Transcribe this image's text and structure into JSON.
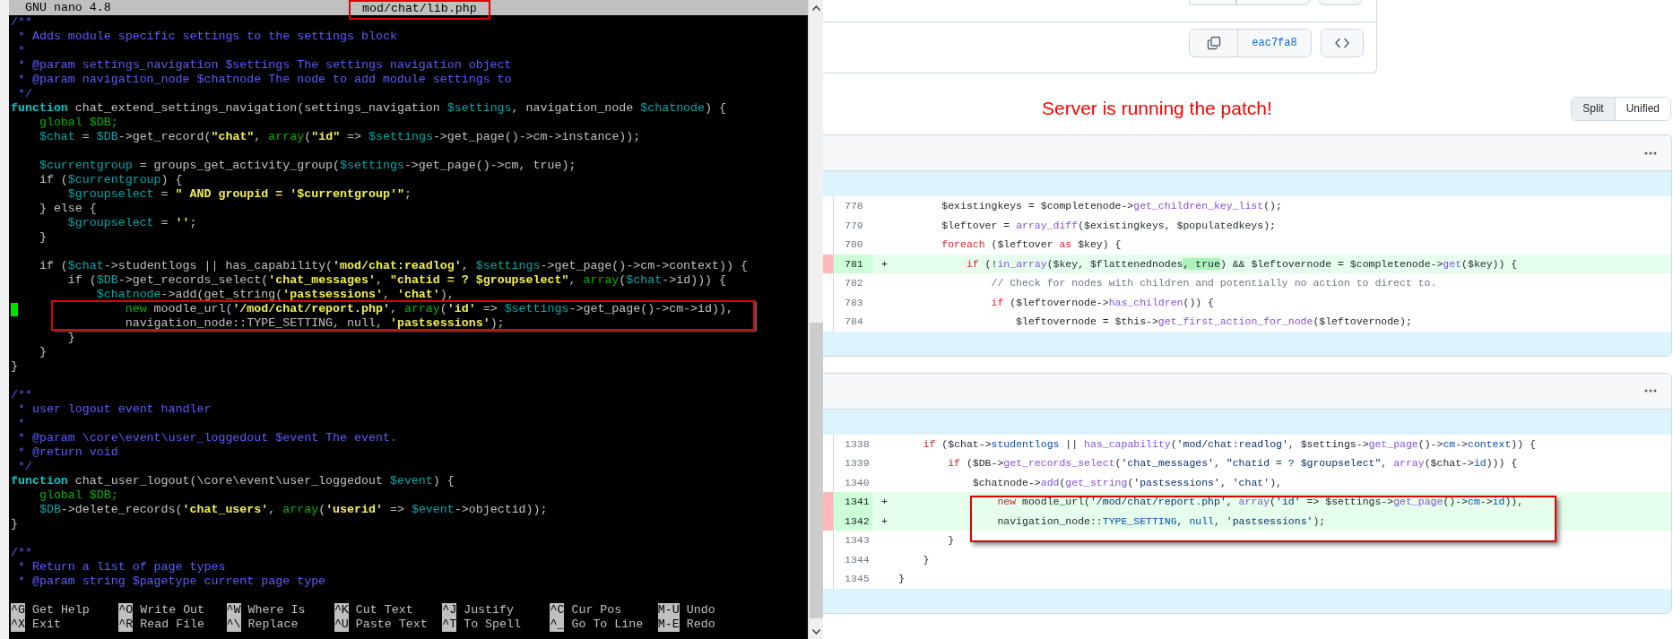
{
  "terminal": {
    "app": "GNU nano 4.8",
    "file": "mod/chat/lib.php",
    "lines": [
      {
        "kind": "code",
        "cursor": false,
        "tokens": [
          {
            "kind": "comment",
            "text": "/**"
          }
        ]
      },
      {
        "kind": "code",
        "cursor": false,
        "tokens": [
          {
            "kind": "comment",
            "text": " * Adds module specific settings to the settings block"
          }
        ]
      },
      {
        "kind": "code",
        "cursor": false,
        "tokens": [
          {
            "kind": "comment",
            "text": " *"
          }
        ]
      },
      {
        "kind": "code",
        "cursor": false,
        "tokens": [
          {
            "kind": "comment",
            "text": " * @param settings_navigation $settings The settings navigation object"
          }
        ]
      },
      {
        "kind": "code",
        "cursor": false,
        "tokens": [
          {
            "kind": "comment",
            "text": " * @param navigation_node $chatnode The node to add module settings to"
          }
        ]
      },
      {
        "kind": "code",
        "cursor": false,
        "tokens": [
          {
            "kind": "comment",
            "text": " */"
          }
        ]
      },
      {
        "kind": "code",
        "cursor": false,
        "tokens": [
          {
            "kind": "declaration",
            "text": "function"
          },
          {
            "kind": "plain",
            "text": " chat_extend_settings_navigation(settings_navigation "
          },
          {
            "kind": "variable",
            "text": "$settings"
          },
          {
            "kind": "plain",
            "text": ", navigation_node "
          },
          {
            "kind": "variable",
            "text": "$chatnode"
          },
          {
            "kind": "plain",
            "text": ") {"
          }
        ]
      },
      {
        "kind": "code",
        "cursor": false,
        "tokens": [
          {
            "kind": "builtin",
            "text": "    global $DB;"
          }
        ]
      },
      {
        "kind": "code",
        "cursor": false,
        "tokens": [
          {
            "kind": "variable",
            "text": "    $chat"
          },
          {
            "kind": "plain",
            "text": " = "
          },
          {
            "kind": "variable",
            "text": "$DB"
          },
          {
            "kind": "plain",
            "text": "->get_record("
          },
          {
            "kind": "string",
            "text": "\"chat\""
          },
          {
            "kind": "plain",
            "text": ", "
          },
          {
            "kind": "builtin",
            "text": "array"
          },
          {
            "kind": "plain",
            "text": "("
          },
          {
            "kind": "string",
            "text": "\"id\""
          },
          {
            "kind": "plain",
            "text": " => "
          },
          {
            "kind": "variable",
            "text": "$settings"
          },
          {
            "kind": "plain",
            "text": "->get_page()->cm->instance));"
          }
        ]
      },
      {
        "kind": "blank"
      },
      {
        "kind": "code",
        "cursor": false,
        "tokens": [
          {
            "kind": "variable",
            "text": "    $currentgroup"
          },
          {
            "kind": "plain",
            "text": " = groups_get_activity_group("
          },
          {
            "kind": "variable",
            "text": "$settings"
          },
          {
            "kind": "plain",
            "text": "->get_page()->cm, true);"
          }
        ]
      },
      {
        "kind": "code",
        "cursor": false,
        "tokens": [
          {
            "kind": "plain",
            "text": "    if ("
          },
          {
            "kind": "variable",
            "text": "$currentgroup"
          },
          {
            "kind": "plain",
            "text": ") {"
          }
        ]
      },
      {
        "kind": "code",
        "cursor": false,
        "tokens": [
          {
            "kind": "variable",
            "text": "        $groupselect"
          },
          {
            "kind": "plain",
            "text": " = "
          },
          {
            "kind": "string",
            "text": "\" AND groupid = '$currentgroup'\""
          },
          {
            "kind": "plain",
            "text": ";"
          }
        ]
      },
      {
        "kind": "code",
        "cursor": false,
        "tokens": [
          {
            "kind": "plain",
            "text": "    } else {"
          }
        ]
      },
      {
        "kind": "code",
        "cursor": false,
        "tokens": [
          {
            "kind": "variable",
            "text": "        $groupselect"
          },
          {
            "kind": "plain",
            "text": " = "
          },
          {
            "kind": "string",
            "text": "''"
          },
          {
            "kind": "plain",
            "text": ";"
          }
        ]
      },
      {
        "kind": "code",
        "cursor": false,
        "tokens": [
          {
            "kind": "plain",
            "text": "    }"
          }
        ]
      },
      {
        "kind": "blank"
      },
      {
        "kind": "code",
        "cursor": false,
        "tokens": [
          {
            "kind": "plain",
            "text": "    if ("
          },
          {
            "kind": "variable",
            "text": "$chat"
          },
          {
            "kind": "plain",
            "text": "->studentlogs || has_capability("
          },
          {
            "kind": "string",
            "text": "'mod/chat:readlog'"
          },
          {
            "kind": "plain",
            "text": ", "
          },
          {
            "kind": "variable",
            "text": "$settings"
          },
          {
            "kind": "plain",
            "text": "->get_page()->cm->context)) {"
          }
        ]
      },
      {
        "kind": "code",
        "cursor": false,
        "tokens": [
          {
            "kind": "plain",
            "text": "        if ("
          },
          {
            "kind": "variable",
            "text": "$DB"
          },
          {
            "kind": "plain",
            "text": "->get_records_select("
          },
          {
            "kind": "string",
            "text": "'chat_messages'"
          },
          {
            "kind": "plain",
            "text": ", "
          },
          {
            "kind": "string",
            "text": "\"chatid = ? $groupselect\""
          },
          {
            "kind": "plain",
            "text": ", "
          },
          {
            "kind": "builtin",
            "text": "array"
          },
          {
            "kind": "plain",
            "text": "("
          },
          {
            "kind": "variable",
            "text": "$chat"
          },
          {
            "kind": "plain",
            "text": "->id))) {"
          }
        ]
      },
      {
        "kind": "code",
        "cursor": false,
        "tokens": [
          {
            "kind": "variable",
            "text": "            $chatnode"
          },
          {
            "kind": "plain",
            "text": "->add(get_string("
          },
          {
            "kind": "string",
            "text": "'pastsessions'"
          },
          {
            "kind": "plain",
            "text": ", "
          },
          {
            "kind": "string",
            "text": "'chat'"
          },
          {
            "kind": "plain",
            "text": "),"
          }
        ]
      },
      {
        "kind": "code",
        "cursor": true,
        "tokens": [
          {
            "kind": "builtin",
            "text": "                new"
          },
          {
            "kind": "plain",
            "text": " moodle_url("
          },
          {
            "kind": "string",
            "text": "'/mod/chat/report.php'"
          },
          {
            "kind": "plain",
            "text": ", "
          },
          {
            "kind": "builtin",
            "text": "array"
          },
          {
            "kind": "plain",
            "text": "("
          },
          {
            "kind": "string",
            "text": "'id'"
          },
          {
            "kind": "plain",
            "text": " => "
          },
          {
            "kind": "variable",
            "text": "$settings"
          },
          {
            "kind": "plain",
            "text": "->get_page()->cm->id)),"
          }
        ]
      },
      {
        "kind": "code",
        "cursor": false,
        "tokens": [
          {
            "kind": "plain",
            "text": "                navigation_node::TYPE_SETTING, null, "
          },
          {
            "kind": "string",
            "text": "'pastsessions'"
          },
          {
            "kind": "plain",
            "text": ");"
          }
        ]
      },
      {
        "kind": "code",
        "cursor": false,
        "tokens": [
          {
            "kind": "plain",
            "text": "        }"
          }
        ]
      },
      {
        "kind": "code",
        "cursor": false,
        "tokens": [
          {
            "kind": "plain",
            "text": "    }"
          }
        ]
      },
      {
        "kind": "code",
        "cursor": false,
        "tokens": [
          {
            "kind": "plain",
            "text": "}"
          }
        ]
      },
      {
        "kind": "blank"
      },
      {
        "kind": "code",
        "cursor": false,
        "tokens": [
          {
            "kind": "comment",
            "text": "/**"
          }
        ]
      },
      {
        "kind": "code",
        "cursor": false,
        "tokens": [
          {
            "kind": "comment",
            "text": " * user logout event handler"
          }
        ]
      },
      {
        "kind": "code",
        "cursor": false,
        "tokens": [
          {
            "kind": "comment",
            "text": " *"
          }
        ]
      },
      {
        "kind": "code",
        "cursor": false,
        "tokens": [
          {
            "kind": "comment",
            "text": " * @param \\core\\event\\user_loggedout $event The event."
          }
        ]
      },
      {
        "kind": "code",
        "cursor": false,
        "tokens": [
          {
            "kind": "comment",
            "text": " * @return void"
          }
        ]
      },
      {
        "kind": "code",
        "cursor": false,
        "tokens": [
          {
            "kind": "comment",
            "text": " */"
          }
        ]
      },
      {
        "kind": "code",
        "cursor": false,
        "tokens": [
          {
            "kind": "declaration",
            "text": "function"
          },
          {
            "kind": "plain",
            "text": " chat_user_logout(\\core\\event\\user_loggedout "
          },
          {
            "kind": "variable",
            "text": "$event"
          },
          {
            "kind": "plain",
            "text": ") {"
          }
        ]
      },
      {
        "kind": "code",
        "cursor": false,
        "tokens": [
          {
            "kind": "builtin",
            "text": "    global $DB;"
          }
        ]
      },
      {
        "kind": "code",
        "cursor": false,
        "tokens": [
          {
            "kind": "variable",
            "text": "    $DB"
          },
          {
            "kind": "plain",
            "text": "->delete_records("
          },
          {
            "kind": "string",
            "text": "'chat_users'"
          },
          {
            "kind": "plain",
            "text": ", "
          },
          {
            "kind": "builtin",
            "text": "array"
          },
          {
            "kind": "plain",
            "text": "("
          },
          {
            "kind": "string",
            "text": "'userid'"
          },
          {
            "kind": "plain",
            "text": " => "
          },
          {
            "kind": "variable",
            "text": "$event"
          },
          {
            "kind": "plain",
            "text": "->objectid));"
          }
        ]
      },
      {
        "kind": "code",
        "cursor": false,
        "tokens": [
          {
            "kind": "plain",
            "text": "}"
          }
        ]
      },
      {
        "kind": "blank"
      },
      {
        "kind": "code",
        "cursor": false,
        "tokens": [
          {
            "kind": "comment",
            "text": "/**"
          }
        ]
      },
      {
        "kind": "code",
        "cursor": false,
        "tokens": [
          {
            "kind": "comment",
            "text": " * Return a list of page types"
          }
        ]
      },
      {
        "kind": "code",
        "cursor": false,
        "tokens": [
          {
            "kind": "comment",
            "text": " * @param string $pagetype current page type"
          }
        ]
      },
      {
        "kind": "blank"
      }
    ],
    "shortcut_rows": [
      [
        {
          "key": "^G",
          "label": "Get Help"
        },
        {
          "key": "^O",
          "label": "Write Out"
        },
        {
          "key": "^W",
          "label": "Where Is"
        },
        {
          "key": "^K",
          "label": "Cut Text"
        },
        {
          "key": "^J",
          "label": "Justify"
        },
        {
          "key": "^C",
          "label": "Cur Pos"
        },
        {
          "key": "M-U",
          "label": "Undo"
        }
      ],
      [
        {
          "key": "^X",
          "label": "Exit"
        },
        {
          "key": "^R",
          "label": "Read File"
        },
        {
          "key": "^\\",
          "label": "Replace"
        },
        {
          "key": "^U",
          "label": "Paste Text"
        },
        {
          "key": "^T",
          "label": "To Spell"
        },
        {
          "key": "^_",
          "label": "Go To Line"
        },
        {
          "key": "M-E",
          "label": "Redo"
        }
      ]
    ]
  },
  "commit_card": {
    "commit_id": "eac7fa8"
  },
  "message": "Server is running the patch!",
  "view_toggle": [
    {
      "label": "Split",
      "selected": true
    },
    {
      "label": "Unified",
      "selected": false
    }
  ],
  "diffs": [
    {
      "rows": [
        {
          "number": "778",
          "added": false,
          "tokens": [
            {
              "kind": "plain",
              "text": "       $existingkeys = $completenode->"
            },
            {
              "kind": "function",
              "text": "get_children_key_list"
            },
            {
              "kind": "plain",
              "text": "();"
            }
          ]
        },
        {
          "number": "779",
          "added": false,
          "tokens": [
            {
              "kind": "plain",
              "text": "       $leftover = "
            },
            {
              "kind": "function",
              "text": "array_diff"
            },
            {
              "kind": "plain",
              "text": "($existingkeys, $populatedkeys);"
            }
          ]
        },
        {
          "number": "780",
          "added": false,
          "tokens": [
            {
              "kind": "keyword",
              "text": "       foreach"
            },
            {
              "kind": "plain",
              "text": " ($leftover "
            },
            {
              "kind": "keyword",
              "text": "as"
            },
            {
              "kind": "plain",
              "text": " $key) {"
            }
          ]
        },
        {
          "number": "781",
          "added": true,
          "marker": "+",
          "tokens": [
            {
              "kind": "keyword",
              "text": "           if"
            },
            {
              "kind": "plain",
              "text": " (!"
            },
            {
              "kind": "function",
              "text": "in_array"
            },
            {
              "kind": "plain",
              "text": "($key, $flattenednodes"
            },
            {
              "kind": "changed",
              "text": ", true"
            },
            {
              "kind": "plain",
              "text": ") && $leftovernode = $completenode->"
            },
            {
              "kind": "function",
              "text": "get"
            },
            {
              "kind": "plain",
              "text": "($key)) {"
            }
          ]
        },
        {
          "number": "782",
          "added": false,
          "tokens": [
            {
              "kind": "comment",
              "text": "               // Check for nodes with children and potentially no action to direct to."
            }
          ]
        },
        {
          "number": "783",
          "added": false,
          "tokens": [
            {
              "kind": "keyword",
              "text": "               if"
            },
            {
              "kind": "plain",
              "text": " ($leftovernode->"
            },
            {
              "kind": "function",
              "text": "has_children"
            },
            {
              "kind": "plain",
              "text": "()) {"
            }
          ]
        },
        {
          "number": "784",
          "added": false,
          "tokens": [
            {
              "kind": "plain",
              "text": "                   $leftovernode = $this->"
            },
            {
              "kind": "function",
              "text": "get_first_action_for_node"
            },
            {
              "kind": "plain",
              "text": "($leftovernode);"
            }
          ]
        }
      ]
    },
    {
      "rows": [
        {
          "number": "1338",
          "added": false,
          "tokens": [
            {
              "kind": "keyword",
              "text": "    if"
            },
            {
              "kind": "plain",
              "text": " ($chat->"
            },
            {
              "kind": "constant",
              "text": "studentlogs"
            },
            {
              "kind": "plain",
              "text": " || "
            },
            {
              "kind": "function",
              "text": "has_capability"
            },
            {
              "kind": "plain",
              "text": "("
            },
            {
              "kind": "string",
              "text": "'mod/chat:readlog'"
            },
            {
              "kind": "plain",
              "text": ", $settings->"
            },
            {
              "kind": "function",
              "text": "get_page"
            },
            {
              "kind": "plain",
              "text": "()->"
            },
            {
              "kind": "constant",
              "text": "cm"
            },
            {
              "kind": "plain",
              "text": "->"
            },
            {
              "kind": "constant",
              "text": "context"
            },
            {
              "kind": "plain",
              "text": ")) {"
            }
          ]
        },
        {
          "number": "1339",
          "added": false,
          "tokens": [
            {
              "kind": "keyword",
              "text": "        if"
            },
            {
              "kind": "plain",
              "text": " ($DB->"
            },
            {
              "kind": "function",
              "text": "get_records_select"
            },
            {
              "kind": "plain",
              "text": "("
            },
            {
              "kind": "string",
              "text": "'chat_messages'"
            },
            {
              "kind": "plain",
              "text": ", "
            },
            {
              "kind": "string",
              "text": "\"chatid = ? $groupselect\""
            },
            {
              "kind": "plain",
              "text": ", "
            },
            {
              "kind": "function",
              "text": "array"
            },
            {
              "kind": "plain",
              "text": "($chat->"
            },
            {
              "kind": "constant",
              "text": "id"
            },
            {
              "kind": "plain",
              "text": "))) {"
            }
          ]
        },
        {
          "number": "1340",
          "added": false,
          "tokens": [
            {
              "kind": "plain",
              "text": "            $chatnode->"
            },
            {
              "kind": "function",
              "text": "add"
            },
            {
              "kind": "plain",
              "text": "("
            },
            {
              "kind": "function",
              "text": "get_string"
            },
            {
              "kind": "plain",
              "text": "("
            },
            {
              "kind": "string",
              "text": "'pastsessions'"
            },
            {
              "kind": "plain",
              "text": ", "
            },
            {
              "kind": "string",
              "text": "'chat'"
            },
            {
              "kind": "plain",
              "text": "),"
            }
          ]
        },
        {
          "number": "1341",
          "added": true,
          "marker": "+",
          "tokens": [
            {
              "kind": "keyword",
              "text": "                new"
            },
            {
              "kind": "plain",
              "text": " moodle_url("
            },
            {
              "kind": "string",
              "text": "'/mod/chat/report.php'"
            },
            {
              "kind": "plain",
              "text": ", "
            },
            {
              "kind": "function",
              "text": "array"
            },
            {
              "kind": "plain",
              "text": "("
            },
            {
              "kind": "string",
              "text": "'id'"
            },
            {
              "kind": "plain",
              "text": " => $settings->"
            },
            {
              "kind": "function",
              "text": "get_page"
            },
            {
              "kind": "plain",
              "text": "()->"
            },
            {
              "kind": "constant",
              "text": "cm"
            },
            {
              "kind": "plain",
              "text": "->"
            },
            {
              "kind": "constant",
              "text": "id"
            },
            {
              "kind": "plain",
              "text": ")),"
            }
          ]
        },
        {
          "number": "1342",
          "added": true,
          "marker": "+",
          "tokens": [
            {
              "kind": "plain",
              "text": "                navigation_node::"
            },
            {
              "kind": "constant",
              "text": "TYPE_SETTING"
            },
            {
              "kind": "plain",
              "text": ", "
            },
            {
              "kind": "constant",
              "text": "null"
            },
            {
              "kind": "plain",
              "text": ", "
            },
            {
              "kind": "string",
              "text": "'pastsessions'"
            },
            {
              "kind": "plain",
              "text": ");"
            }
          ]
        },
        {
          "number": "1343",
          "added": false,
          "tokens": [
            {
              "kind": "plain",
              "text": "        }"
            }
          ]
        },
        {
          "number": "1344",
          "added": false,
          "tokens": [
            {
              "kind": "plain",
              "text": "    }"
            }
          ]
        },
        {
          "number": "1345",
          "added": false,
          "tokens": [
            {
              "kind": "plain",
              "text": "}"
            }
          ]
        }
      ]
    }
  ]
}
